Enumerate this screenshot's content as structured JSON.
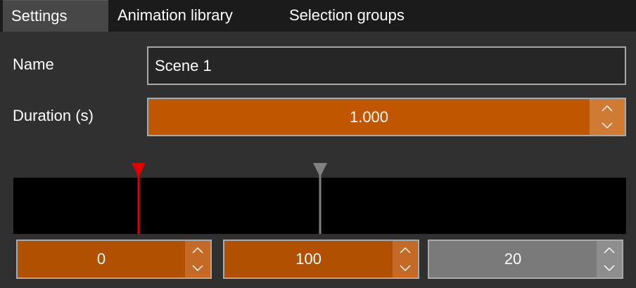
{
  "tabs": [
    {
      "label": "Settings",
      "active": true
    },
    {
      "label": "Animation library",
      "active": false
    },
    {
      "label": "Selection groups",
      "active": false
    }
  ],
  "settings": {
    "name_label": "Name",
    "name_value": "Scene 1",
    "duration_label": "Duration (s)",
    "duration_value": "1.000"
  },
  "timeline": {
    "start_value": "0",
    "end_value": "100",
    "fps_value": "20",
    "playhead_color": "#e00000",
    "end_marker_color": "#808080"
  },
  "icons": {
    "spinner_up": "chevron-up-icon",
    "spinner_down": "chevron-down-icon",
    "playhead": "triangle-marker-icon"
  },
  "colors": {
    "accent_orange": "#c05600",
    "panel_bg": "#303030",
    "tabbar_bg": "#1b1b1b",
    "timeline_bg": "#000000"
  }
}
